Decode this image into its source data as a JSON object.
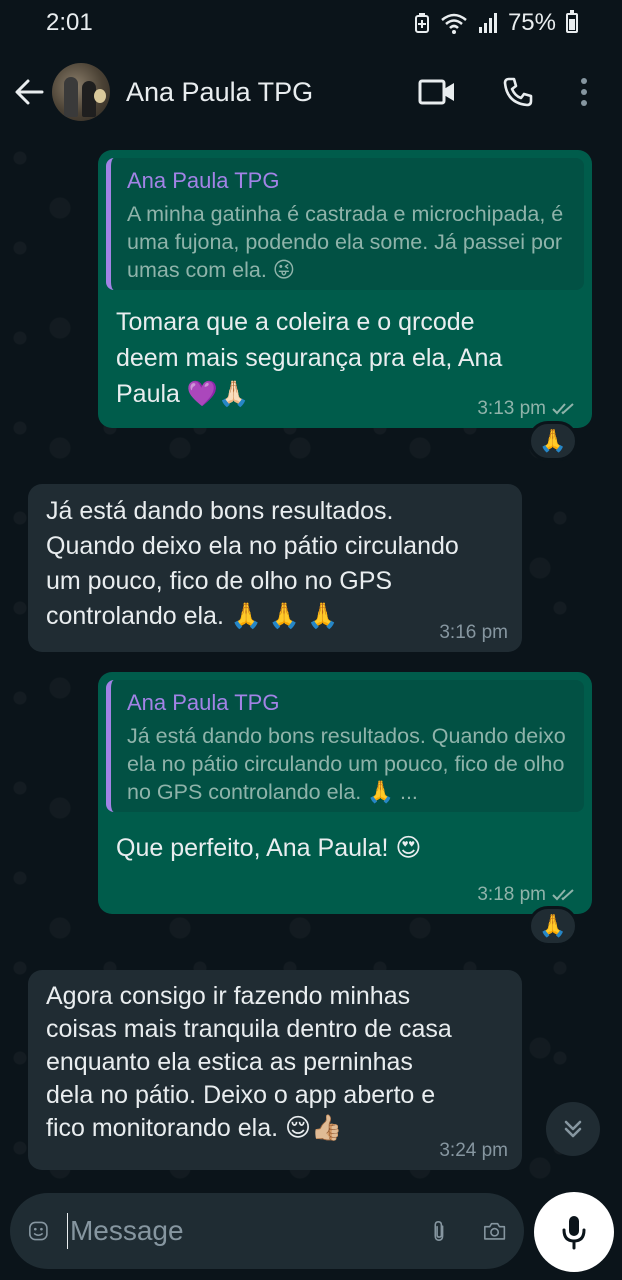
{
  "status_bar": {
    "time": "2:01",
    "battery": "75%"
  },
  "header": {
    "contact_name": "Ana Paula TPG"
  },
  "messages": [
    {
      "direction": "outgoing",
      "quote": {
        "author": "Ana Paula TPG",
        "text": "A minha gatinha é castrada e microchipada, é uma fujona, podendo ela some. Já passei por umas com ela. 😜"
      },
      "text_lines": [
        "Tomara que a coleira e o qrcode",
        "deem mais segurança pra ela, Ana",
        "Paula 💜🙏🏻"
      ],
      "time": "3:13 pm",
      "reaction": "🙏"
    },
    {
      "direction": "incoming",
      "text_lines": [
        "Já está dando bons resultados.",
        "Quando deixo ela no pátio circulando",
        "um pouco, fico de olho no GPS",
        "controlando ela. 🙏 🙏 🙏"
      ],
      "time": "3:16 pm"
    },
    {
      "direction": "outgoing",
      "quote": {
        "author": "Ana Paula TPG",
        "text": "Já está dando bons resultados. Quando deixo ela no pátio circulando  um pouco, fico de olho no GPS controlando ela. 🙏 ..."
      },
      "text_lines": [
        "Que perfeito, Ana Paula! 😍"
      ],
      "time": "3:18 pm",
      "reaction": "🙏"
    },
    {
      "direction": "incoming",
      "text_lines": [
        "Agora consigo ir fazendo minhas",
        "coisas mais tranquila dentro de casa",
        "enquanto ela estica as perninhas",
        "dela no pátio. Deixo o app aberto e",
        "fico monitorando ela. 😌👍🏼"
      ],
      "time": "3:24 pm"
    }
  ],
  "composer": {
    "placeholder": "Message"
  },
  "colors": {
    "outgoing_bubble": "#005c4b",
    "incoming_bubble": "#202c33",
    "quote_accent": "#a283e6",
    "background": "#0b141a"
  },
  "icons": [
    "back-arrow-icon",
    "video-call-icon",
    "phone-icon",
    "more-options-icon",
    "emoji-icon",
    "attach-icon",
    "camera-icon",
    "mic-icon",
    "double-check-icon",
    "chevron-double-down-icon"
  ]
}
